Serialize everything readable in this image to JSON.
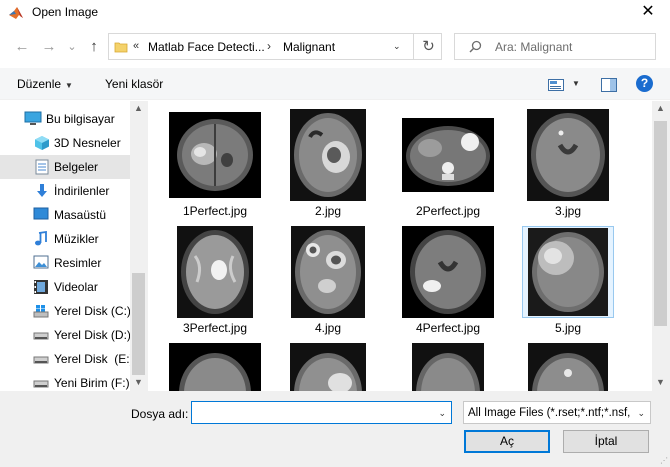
{
  "window": {
    "title": "Open Image",
    "close_glyph": "✕"
  },
  "nav_buttons": {
    "back": "←",
    "forward": "→",
    "recent": "⌄",
    "up": "↑"
  },
  "address": {
    "overflow": "«",
    "crumbs": [
      "Matlab Face Detecti...",
      "Malignant"
    ],
    "separator": "›",
    "dropdown": "⌄",
    "refresh": "↻"
  },
  "search": {
    "placeholder": "Ara: Malignant"
  },
  "toolbar": {
    "organize": "Düzenle",
    "organize_caret": "▼",
    "new_folder": "Yeni klasör",
    "view_caret": "▼",
    "help": "?"
  },
  "sidebar": {
    "items": [
      {
        "label": "Bu bilgisayar",
        "icon": "computer-icon"
      },
      {
        "label": "3D Nesneler",
        "icon": "cube-icon"
      },
      {
        "label": "Belgeler",
        "icon": "documents-icon"
      },
      {
        "label": "İndirilenler",
        "icon": "download-icon"
      },
      {
        "label": "Masaüstü",
        "icon": "desktop-icon"
      },
      {
        "label": "Müzikler",
        "icon": "music-icon"
      },
      {
        "label": "Resimler",
        "icon": "pictures-icon"
      },
      {
        "label": "Videolar",
        "icon": "videos-icon"
      },
      {
        "label": "Yerel Disk (C:)",
        "icon": "windows-drive-icon"
      },
      {
        "label": "Yerel Disk (D:)",
        "icon": "drive-icon"
      },
      {
        "label": "Yerel Disk  (E:)",
        "icon": "drive-icon"
      },
      {
        "label": "Yeni Birim (F:)",
        "icon": "drive-icon"
      }
    ]
  },
  "files": [
    {
      "name": "1Perfect.jpg"
    },
    {
      "name": "2.jpg"
    },
    {
      "name": "2Perfect.jpg"
    },
    {
      "name": "3.jpg"
    },
    {
      "name": "3Perfect.jpg"
    },
    {
      "name": "4.jpg"
    },
    {
      "name": "4Perfect.jpg"
    },
    {
      "name": "5.jpg"
    },
    {
      "name": ""
    },
    {
      "name": ""
    },
    {
      "name": ""
    },
    {
      "name": ""
    }
  ],
  "scroll_arrows": {
    "up": "▲",
    "down": "▼",
    "left": "‹",
    "right": "›"
  },
  "bottom": {
    "filename_label": "Dosya adı:",
    "filename_value": "",
    "filter_value": "All Image Files (*.rset;*.ntf;*.nsf,",
    "dropdown_glyph": "⌄",
    "open_label": "Aç",
    "cancel_label": "İptal",
    "grip": "⋰"
  }
}
